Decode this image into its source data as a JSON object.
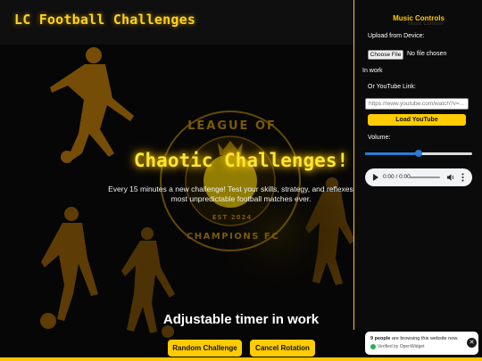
{
  "header": {
    "title": "LC Football Challenges"
  },
  "logo": {
    "top_text": "LEAGUE OF",
    "bottom_text": "CHAMPIONS FC",
    "est_text": "EST 2024"
  },
  "hero": {
    "title": "Chaotic Challenges!",
    "description": "Every 15 minutes a new challenge! Test your skills, strategy, and reflexes in the most unpredictable football matches ever."
  },
  "timer": {
    "text": "Adjustable timer in work"
  },
  "buttons": {
    "random": "Random Challenge",
    "cancel": "Cancel Rotation"
  },
  "music": {
    "title": "Music Controls",
    "title_shadow": "Music Controls",
    "upload_label": "Upload from Device:",
    "choose_file": "Choose File",
    "file_status": "No file chosen",
    "in_work": "In work",
    "youtube_label": "Or YouTube Link:",
    "youtube_placeholder": "https://www.youtube.com/watch?v=...",
    "load_button": "Load YouTube",
    "volume_label": "Volume:",
    "volume_level": 0.5,
    "player_time": "0:00 / 0:00"
  },
  "toast": {
    "count": "9 people",
    "message": " are browsing this website now.",
    "verified": "Verified by OpenWidget",
    "close_icon": "close-icon"
  },
  "colors": {
    "accent": "#ffcc00",
    "title_glow": "#ffe433",
    "panel_bg": "#0b0b0b",
    "volume": "#2a7ad8"
  }
}
